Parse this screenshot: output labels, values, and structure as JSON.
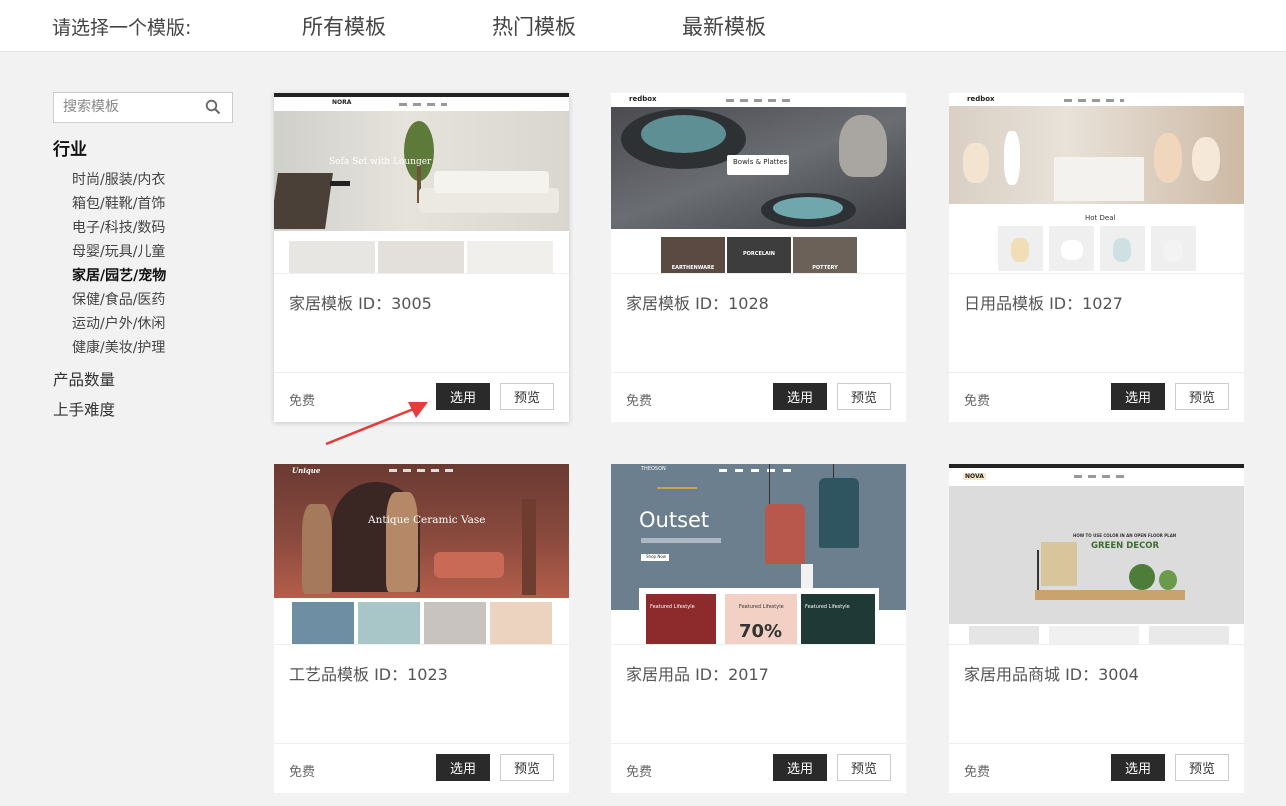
{
  "header": {
    "prompt": "请选择一个模版:",
    "tabs": [
      "所有模板",
      "热门模板",
      "最新模板"
    ]
  },
  "sidebar": {
    "search_placeholder": "搜索模板",
    "industry_heading": "行业",
    "industries": [
      "时尚/服装/内衣",
      "箱包/鞋靴/首饰",
      "电子/科技/数码",
      "母婴/玩具/儿童",
      "家居/园艺/宠物",
      "保健/食品/医药",
      "运动/户外/休闲",
      "健康/美妆/护理"
    ],
    "active_industry_index": 4,
    "filters": [
      "产品数量",
      "上手难度"
    ]
  },
  "cards": [
    {
      "title": "家居模板 ID：3005",
      "price": "免费",
      "use_label": "选用",
      "preview_label": "预览",
      "thumb": {
        "logo": "NORA",
        "hero_text": "Sofa Set with Lounger",
        "button": "SHOP NOW"
      }
    },
    {
      "title": "家居模板 ID：1028",
      "price": "免费",
      "use_label": "选用",
      "preview_label": "预览",
      "thumb": {
        "logo": "redbox",
        "hero_text": "Bowls & Plattes",
        "categories": [
          "EARTHENWARE",
          "PORCELAIN",
          "POTTERY"
        ]
      }
    },
    {
      "title": "日用品模板 ID：1027",
      "price": "免费",
      "use_label": "选用",
      "preview_label": "预览",
      "thumb": {
        "logo": "redbox",
        "section": "Hot Deal"
      }
    },
    {
      "title": "工艺品模板 ID：1023",
      "price": "免费",
      "use_label": "选用",
      "preview_label": "预览",
      "thumb": {
        "logo": "Unique",
        "hero_text": "Antique Ceramic Vase"
      }
    },
    {
      "title": "家居用品 ID：2017",
      "price": "免费",
      "use_label": "选用",
      "preview_label": "预览",
      "thumb": {
        "logo": "THEOSON",
        "hero_text": "Outset",
        "button": "Shop Now",
        "promo_1": "Featured Lifestyle",
        "promo_2": "Featured Lifestyle",
        "promo_3": "Featured Lifestyle",
        "promo_big": "70%"
      }
    },
    {
      "title": "家居用品商城 ID：3004",
      "price": "免费",
      "use_label": "选用",
      "preview_label": "预览",
      "thumb": {
        "logo": "NOVA",
        "hero_small": "HOW TO USE COLOR IN AN OPEN FLOOR PLAN",
        "hero_text": "GREEN DECOR"
      }
    }
  ],
  "colors": {
    "page_bg": "#f2f2f2",
    "button_dark": "#2a2a2a",
    "annotation_arrow": "#e8393b"
  }
}
